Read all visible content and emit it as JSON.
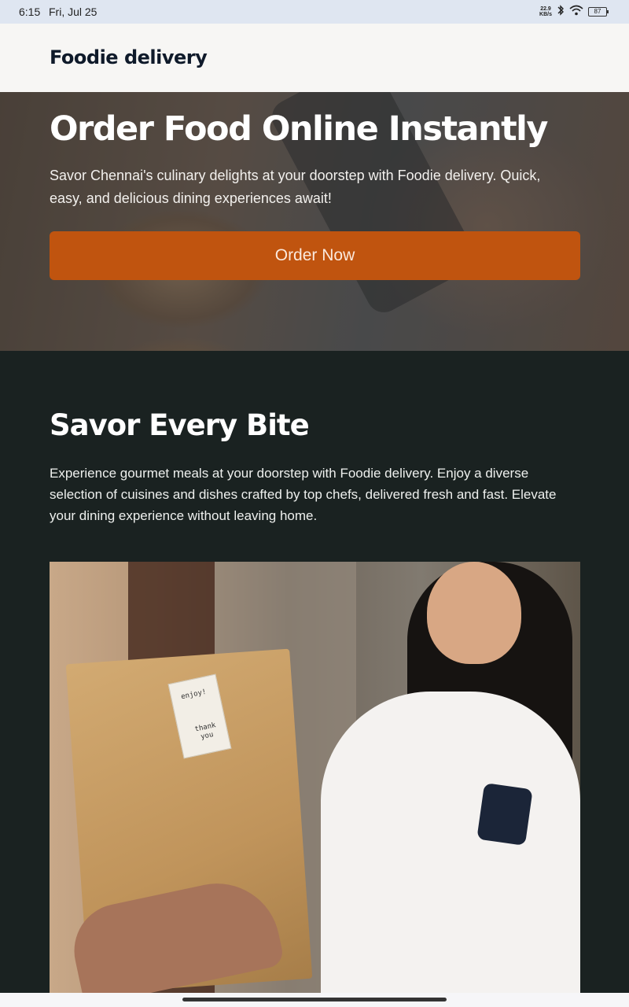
{
  "status_bar": {
    "time": "6:15",
    "date": "Fri, Jul 25",
    "net_speed_value": "22.9",
    "net_speed_unit": "KB/s",
    "battery": "87"
  },
  "header": {
    "brand": "Foodie delivery"
  },
  "hero": {
    "title": "Order Food Online Instantly",
    "description": "Savor Chennai's culinary delights at your doorstep with Foodie delivery. Quick, easy, and delicious dining experiences await!",
    "cta_label": "Order Now",
    "cta_color": "#c0540f"
  },
  "section": {
    "title": "Savor Every Bite",
    "description": "Experience gourmet meals at your doorstep with Foodie delivery. Enjoy a diverse selection of cuisines and dishes crafted by top chefs, delivered fresh and fast. Elevate your dining experience without leaving home.",
    "image": {
      "label_line1": "enjoy!",
      "label_line2": "thank you"
    }
  },
  "colors": {
    "header_bg": "#f7f6f4",
    "section_bg": "#1a2221",
    "status_bg": "#dfe6f1"
  }
}
